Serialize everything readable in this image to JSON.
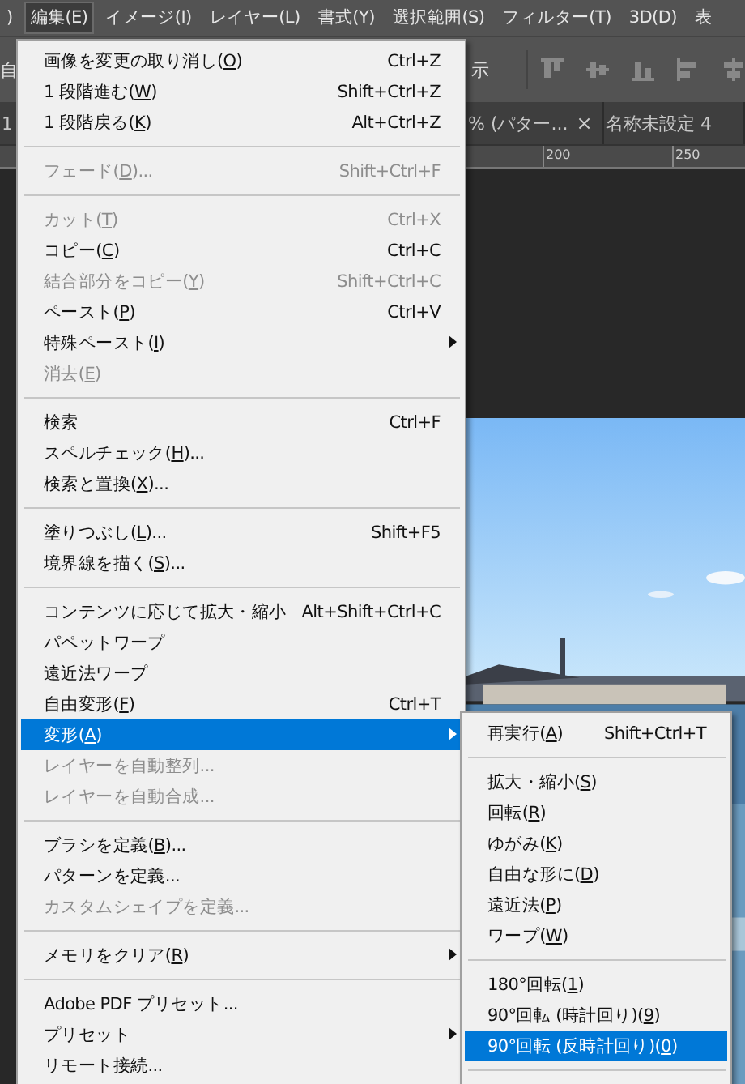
{
  "menubar": [
    {
      "label": ")",
      "selected": false
    },
    {
      "label": "編集(E)",
      "selected": true
    },
    {
      "label": "イメージ(I)",
      "selected": false
    },
    {
      "label": "レイヤー(L)",
      "selected": false
    },
    {
      "label": "書式(Y)",
      "selected": false
    },
    {
      "label": "選択範囲(S)",
      "selected": false
    },
    {
      "label": "フィルター(T)",
      "selected": false
    },
    {
      "label": "3D(D)",
      "selected": false
    },
    {
      "label": "表",
      "selected": false
    }
  ],
  "options_bar": {
    "left_fragment": "自",
    "label": "示"
  },
  "tabs": [
    {
      "label": "1"
    },
    {
      "label": "% (パター...",
      "close": "×"
    },
    {
      "label": "名称未設定 4"
    }
  ],
  "ruler": {
    "ticks": [
      "200",
      "250"
    ]
  },
  "edit_menu": {
    "items": [
      {
        "kind": "item",
        "label": "画像を変更の取り消し(O)",
        "shortcut": "Ctrl+Z",
        "disabled": false,
        "submenu": false,
        "selected": false
      },
      {
        "kind": "item",
        "label": "1 段階進む(W)",
        "shortcut": "Shift+Ctrl+Z",
        "disabled": false,
        "submenu": false,
        "selected": false
      },
      {
        "kind": "item",
        "label": "1 段階戻る(K)",
        "shortcut": "Alt+Ctrl+Z",
        "disabled": false,
        "submenu": false,
        "selected": false
      },
      {
        "kind": "separator"
      },
      {
        "kind": "item",
        "label": "フェード(D)...",
        "shortcut": "Shift+Ctrl+F",
        "disabled": true,
        "submenu": false,
        "selected": false
      },
      {
        "kind": "separator"
      },
      {
        "kind": "item",
        "label": "カット(T)",
        "shortcut": "Ctrl+X",
        "disabled": true,
        "submenu": false,
        "selected": false
      },
      {
        "kind": "item",
        "label": "コピー(C)",
        "shortcut": "Ctrl+C",
        "disabled": false,
        "submenu": false,
        "selected": false
      },
      {
        "kind": "item",
        "label": "結合部分をコピー(Y)",
        "shortcut": "Shift+Ctrl+C",
        "disabled": true,
        "submenu": false,
        "selected": false
      },
      {
        "kind": "item",
        "label": "ペースト(P)",
        "shortcut": "Ctrl+V",
        "disabled": false,
        "submenu": false,
        "selected": false
      },
      {
        "kind": "item",
        "label": "特殊ペースト(I)",
        "disabled": false,
        "submenu": true,
        "selected": false
      },
      {
        "kind": "item",
        "label": "消去(E)",
        "disabled": true,
        "submenu": false,
        "selected": false
      },
      {
        "kind": "separator"
      },
      {
        "kind": "item",
        "label": "検索",
        "shortcut": "Ctrl+F",
        "disabled": false,
        "submenu": false,
        "selected": false
      },
      {
        "kind": "item",
        "label": "スペルチェック(H)...",
        "disabled": false,
        "submenu": false,
        "selected": false
      },
      {
        "kind": "item",
        "label": "検索と置換(X)...",
        "disabled": false,
        "submenu": false,
        "selected": false
      },
      {
        "kind": "separator"
      },
      {
        "kind": "item",
        "label": "塗りつぶし(L)...",
        "shortcut": "Shift+F5",
        "disabled": false,
        "submenu": false,
        "selected": false
      },
      {
        "kind": "item",
        "label": "境界線を描く(S)...",
        "disabled": false,
        "submenu": false,
        "selected": false
      },
      {
        "kind": "separator"
      },
      {
        "kind": "item",
        "label": "コンテンツに応じて拡大・縮小",
        "shortcut": "Alt+Shift+Ctrl+C",
        "disabled": false,
        "submenu": false,
        "selected": false
      },
      {
        "kind": "item",
        "label": "パペットワープ",
        "disabled": false,
        "submenu": false,
        "selected": false
      },
      {
        "kind": "item",
        "label": "遠近法ワープ",
        "disabled": false,
        "submenu": false,
        "selected": false
      },
      {
        "kind": "item",
        "label": "自由変形(F)",
        "shortcut": "Ctrl+T",
        "disabled": false,
        "submenu": false,
        "selected": false
      },
      {
        "kind": "item",
        "label": "変形(A)",
        "disabled": false,
        "submenu": true,
        "selected": true
      },
      {
        "kind": "item",
        "label": "レイヤーを自動整列...",
        "disabled": true,
        "submenu": false,
        "selected": false
      },
      {
        "kind": "item",
        "label": "レイヤーを自動合成...",
        "disabled": true,
        "submenu": false,
        "selected": false
      },
      {
        "kind": "separator"
      },
      {
        "kind": "item",
        "label": "ブラシを定義(B)...",
        "disabled": false,
        "submenu": false,
        "selected": false
      },
      {
        "kind": "item",
        "label": "パターンを定義...",
        "disabled": false,
        "submenu": false,
        "selected": false
      },
      {
        "kind": "item",
        "label": "カスタムシェイプを定義...",
        "disabled": true,
        "submenu": false,
        "selected": false
      },
      {
        "kind": "separator"
      },
      {
        "kind": "item",
        "label": "メモリをクリア(R)",
        "disabled": false,
        "submenu": true,
        "selected": false
      },
      {
        "kind": "separator"
      },
      {
        "kind": "item",
        "label": "Adobe PDF プリセット...",
        "disabled": false,
        "submenu": false,
        "selected": false
      },
      {
        "kind": "item",
        "label": "プリセット",
        "disabled": false,
        "submenu": true,
        "selected": false
      },
      {
        "kind": "item",
        "label": "リモート接続...",
        "disabled": false,
        "submenu": false,
        "selected": false
      }
    ]
  },
  "transform_submenu": {
    "items": [
      {
        "kind": "item",
        "label": "再実行(A)",
        "shortcut": "Shift+Ctrl+T",
        "disabled": false,
        "selected": false
      },
      {
        "kind": "separator"
      },
      {
        "kind": "item",
        "label": "拡大・縮小(S)",
        "disabled": false,
        "selected": false
      },
      {
        "kind": "item",
        "label": "回転(R)",
        "disabled": false,
        "selected": false
      },
      {
        "kind": "item",
        "label": "ゆがみ(K)",
        "disabled": false,
        "selected": false
      },
      {
        "kind": "item",
        "label": "自由な形に(D)",
        "disabled": false,
        "selected": false
      },
      {
        "kind": "item",
        "label": "遠近法(P)",
        "disabled": false,
        "selected": false
      },
      {
        "kind": "item",
        "label": "ワープ(W)",
        "disabled": false,
        "selected": false
      },
      {
        "kind": "separator"
      },
      {
        "kind": "item",
        "label": "180°回転(1)",
        "disabled": false,
        "selected": false
      },
      {
        "kind": "item",
        "label": "90°回転 (時計回り)(9)",
        "disabled": false,
        "selected": false
      },
      {
        "kind": "item",
        "label": "90°回転 (反時計回り)(0)",
        "disabled": false,
        "selected": true
      },
      {
        "kind": "separator"
      }
    ]
  }
}
